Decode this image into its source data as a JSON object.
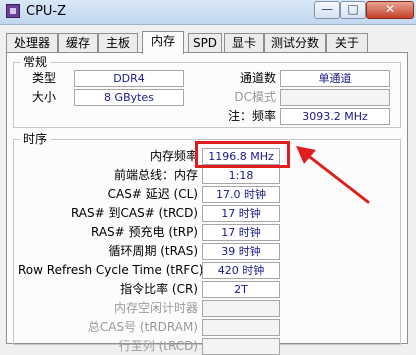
{
  "window": {
    "title": "CPU-Z",
    "controls": {
      "minimize": "—",
      "maximize": "□",
      "close": "✕"
    }
  },
  "tabs": [
    "处理器",
    "缓存",
    "主板",
    "内存",
    "SPD",
    "显卡",
    "测试分数",
    "关于"
  ],
  "active_tab": "内存",
  "general": {
    "title": "常规",
    "type_label": "类型",
    "type_value": "DDR4",
    "size_label": "大小",
    "size_value": "8 GBytes",
    "channels_label": "通道数",
    "channels_value": "单通道",
    "dc_mode_label": "DC模式",
    "dc_mode_value": "",
    "note_freq_label": "注：频率",
    "note_freq_value": "3093.2 MHz"
  },
  "timings": {
    "title": "时序",
    "rows": [
      {
        "label": "内存频率",
        "value": "1196.8 MHz",
        "disabled": false
      },
      {
        "label": "前端总线：内存",
        "value": "1:18",
        "disabled": false
      },
      {
        "label": "CAS# 延迟 (CL)",
        "value": "17.0 时钟",
        "disabled": false
      },
      {
        "label": "RAS# 到CAS# (tRCD)",
        "value": "17 时钟",
        "disabled": false
      },
      {
        "label": "RAS# 预充电 (tRP)",
        "value": "17 时钟",
        "disabled": false
      },
      {
        "label": "循环周期 (tRAS)",
        "value": "39 时钟",
        "disabled": false
      },
      {
        "label": "Row Refresh Cycle Time (tRFC)",
        "value": "420 时钟",
        "disabled": false
      },
      {
        "label": "指令比率 (CR)",
        "value": "2T",
        "disabled": false
      },
      {
        "label": "内存空闲计时器",
        "value": "",
        "disabled": true
      },
      {
        "label": "总CAS号 (tRDRAM)",
        "value": "",
        "disabled": true
      },
      {
        "label": "行至列 (tRCD)",
        "value": "",
        "disabled": true
      }
    ]
  },
  "annotation": {
    "highlight_color": "#e01d1d"
  }
}
